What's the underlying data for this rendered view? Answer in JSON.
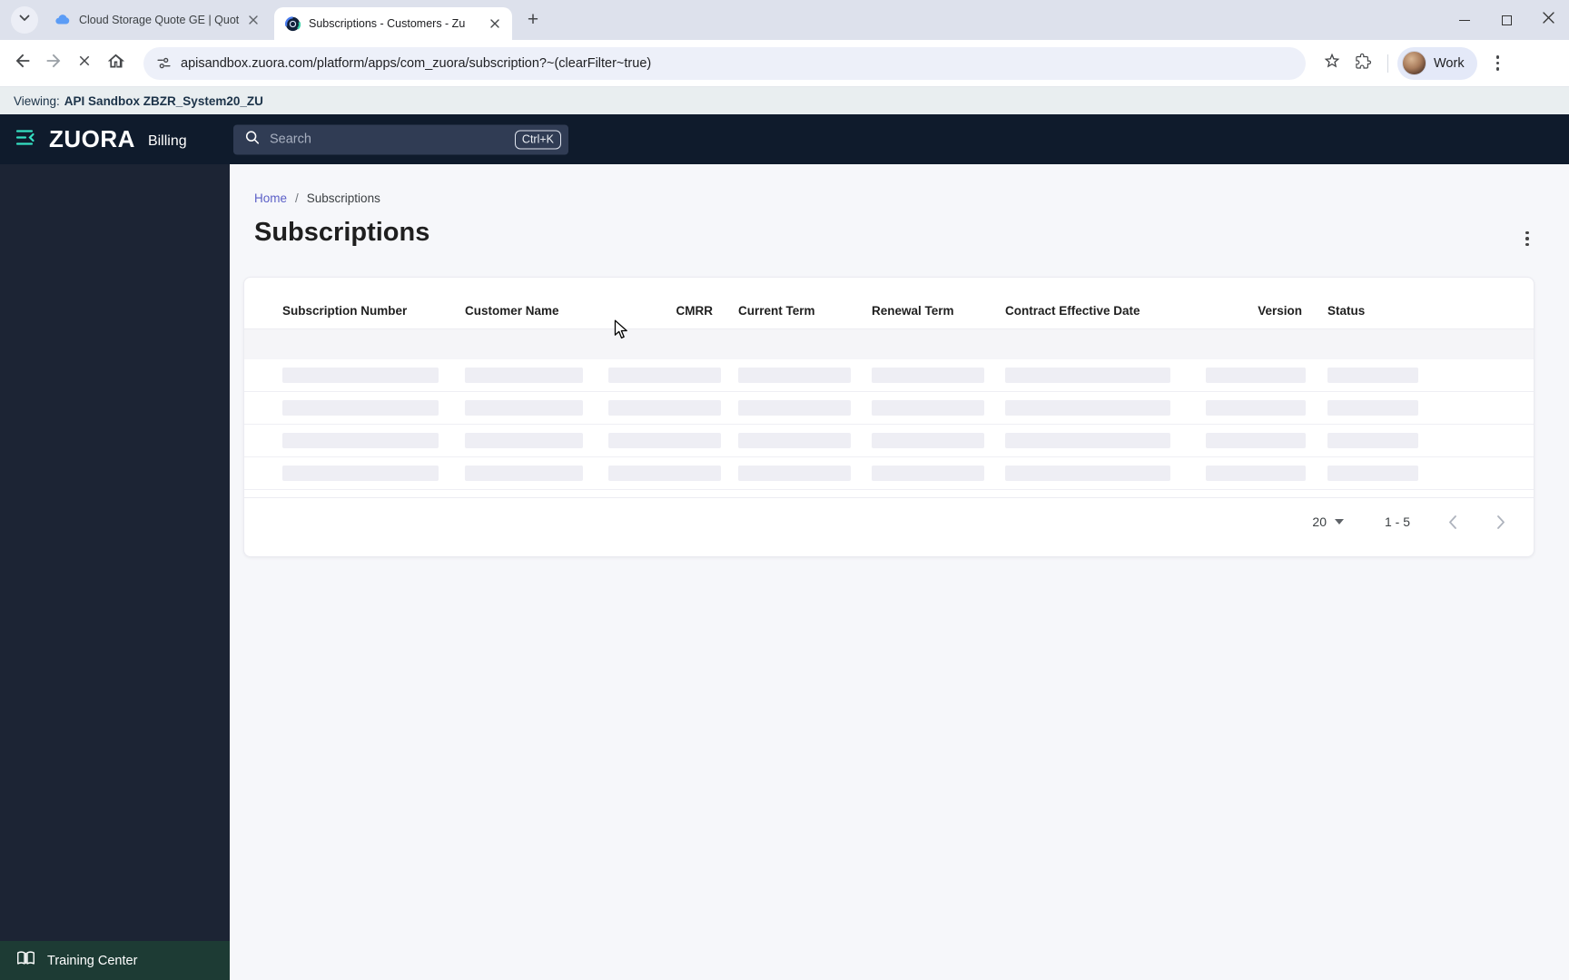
{
  "browser": {
    "tabs": [
      {
        "title": "Cloud Storage Quote GE | Quot",
        "icon": "cloud-icon",
        "active": false
      },
      {
        "title": "Subscriptions - Customers - Zu",
        "icon": "zuora-icon",
        "active": true
      }
    ],
    "url": "apisandbox.zuora.com/platform/apps/com_zuora/subscription?~(clearFilter~true)",
    "profile_label": "Work"
  },
  "env_bar": {
    "prefix": "Viewing:",
    "value": "API Sandbox ZBZR_System20_ZU"
  },
  "app_header": {
    "logo": "ZUORA",
    "product": "Billing",
    "search_placeholder": "Search",
    "search_shortcut": "Ctrl+K"
  },
  "sidebar": {
    "training_center_label": "Training Center"
  },
  "main": {
    "breadcrumb": {
      "home": "Home",
      "separator": "/",
      "current": "Subscriptions"
    },
    "title": "Subscriptions",
    "table": {
      "columns": [
        "Subscription Number",
        "Customer Name",
        "CMRR",
        "Current Term",
        "Renewal Term",
        "Contract Effective Date",
        "Version",
        "Status"
      ],
      "loading_skeleton_rows": 4,
      "pagination": {
        "page_size": "20",
        "range": "1 - 5"
      }
    }
  },
  "colors": {
    "header_navy": "#0f1b2c",
    "sidebar_navy": "#1c2434",
    "accent_teal": "#35e0c2",
    "breadcrumb_link": "#5b5fc7",
    "training_bar": "#1d3b34",
    "skeleton": "#eeeef4"
  }
}
